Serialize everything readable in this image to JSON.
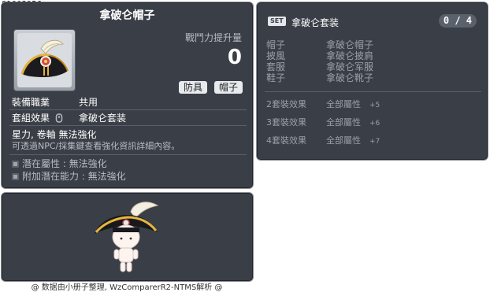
{
  "item_id": "01003956",
  "item": {
    "name": "拿破仑帽子",
    "stat_label": "戰鬥力提升量",
    "stat_value": "0",
    "tags": [
      "防具",
      "帽子"
    ],
    "job_label": "裝備職業",
    "job_value": "共用",
    "set_label": "套組效果",
    "set_value": "拿破仑套装",
    "star_line": "星力, 卷軸 無法強化",
    "info_line": "可透過NPC/採集鍵查看強化資訊詳細內容。",
    "potential_line": "潛在屬性 : 無法強化",
    "bonus_potential_line": "附加潛在能力 : 無法強化"
  },
  "set": {
    "badge": "SET",
    "name": "拿破仑套装",
    "count": "0 / 4",
    "items": [
      {
        "slot": "帽子",
        "name": "拿破仑帽子"
      },
      {
        "slot": "披風",
        "name": "拿破仑披肩"
      },
      {
        "slot": "套服",
        "name": "拿破仑军服"
      },
      {
        "slot": "鞋子",
        "name": "拿破仑靴子"
      }
    ],
    "effects": [
      {
        "level": "2套裝效果",
        "stat": "全部屬性",
        "bonus": "+5"
      },
      {
        "level": "3套裝效果",
        "stat": "全部屬性",
        "bonus": "+6"
      },
      {
        "level": "4套裝效果",
        "stat": "全部屬性",
        "bonus": "+7"
      }
    ]
  },
  "footer": "@ 数据由小册子整理, WzComparerR2-NTMS解析 @",
  "colors": {
    "panel_bg": "#3a3f47",
    "panel_border": "#8a8f96",
    "muted_text": "#b7bcc4"
  },
  "icons": [
    "napoleon-hat-icon",
    "set-link-icon",
    "potential-bullet-icon",
    "bonus-potential-bullet-icon"
  ]
}
